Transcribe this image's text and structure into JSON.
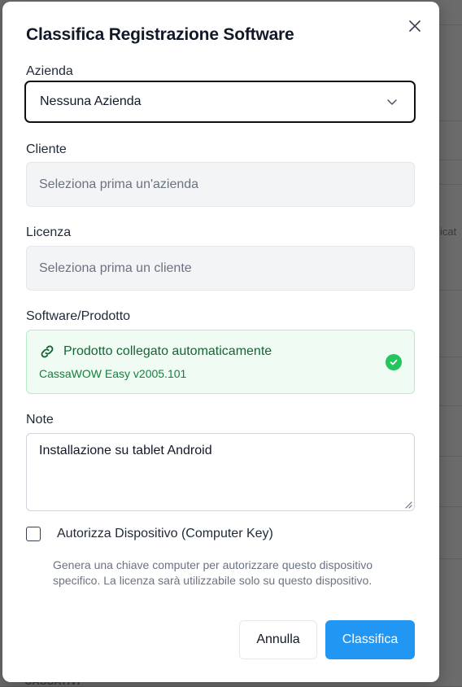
{
  "background": {
    "fragment_right": "icat",
    "fragment_bottom_left": "CASSATIVI"
  },
  "modal": {
    "title": "Classifica Registrazione Software",
    "close_icon": "close-icon"
  },
  "azienda": {
    "label": "Azienda",
    "value": "Nessuna Azienda"
  },
  "cliente": {
    "label": "Cliente",
    "placeholder": "Seleziona prima un'azienda"
  },
  "licenza": {
    "label": "Licenza",
    "placeholder": "Seleziona prima un cliente"
  },
  "software": {
    "label": "Software/Prodotto",
    "status": "Prodotto collegato automaticamente",
    "product": "CassaWOW Easy v2005.101"
  },
  "note": {
    "label": "Note",
    "value": "Installazione su tablet Android"
  },
  "authorize": {
    "label": "Autorizza Dispositivo (Computer Key)",
    "checked": false,
    "help": "Genera una chiave computer per autorizzare questo dispositivo specifico. La licenza sarà utilizzabile solo su questo dispositivo."
  },
  "actions": {
    "cancel": "Annulla",
    "confirm": "Classifica"
  },
  "colors": {
    "primary": "#2196f3",
    "success": "#22c55e",
    "success_bg": "#effbf3"
  }
}
